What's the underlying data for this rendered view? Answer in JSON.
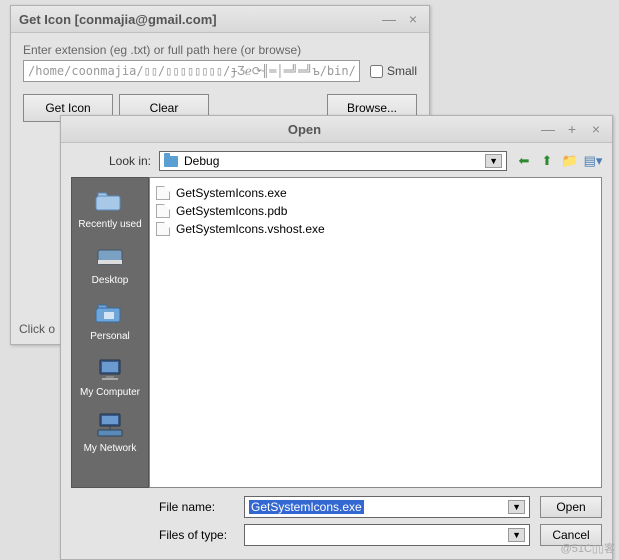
{
  "win1": {
    "title": "Get Icon [conmajia@gmail.com]",
    "label": "Enter extension (eg .txt) or full path here (or browse)",
    "path": "/home/coonmajia/▯▯/▯▯▯▯▯▯▯▯/ɟƷℯ⟳╢═│═╝═╝ъ/bin/De",
    "small": "Small",
    "get_icon": "Get Icon",
    "clear": "Clear",
    "browse": "Browse...",
    "status": "Click o"
  },
  "win2": {
    "title": "Open",
    "lookin_label": "Look in:",
    "lookin_value": "Debug",
    "sidebar": [
      {
        "label": "Recently used"
      },
      {
        "label": "Desktop"
      },
      {
        "label": "Personal"
      },
      {
        "label": "My Computer"
      },
      {
        "label": "My Network"
      }
    ],
    "files": [
      "GetSystemIcons.exe",
      "GetSystemIcons.pdb",
      "GetSystemIcons.vshost.exe"
    ],
    "filename_label": "File name:",
    "filename_value": "GetSystemIcons.exe",
    "filetype_label": "Files of type:",
    "filetype_value": "",
    "open": "Open",
    "cancel": "Cancel"
  },
  "watermark": "@51C▯▯客"
}
